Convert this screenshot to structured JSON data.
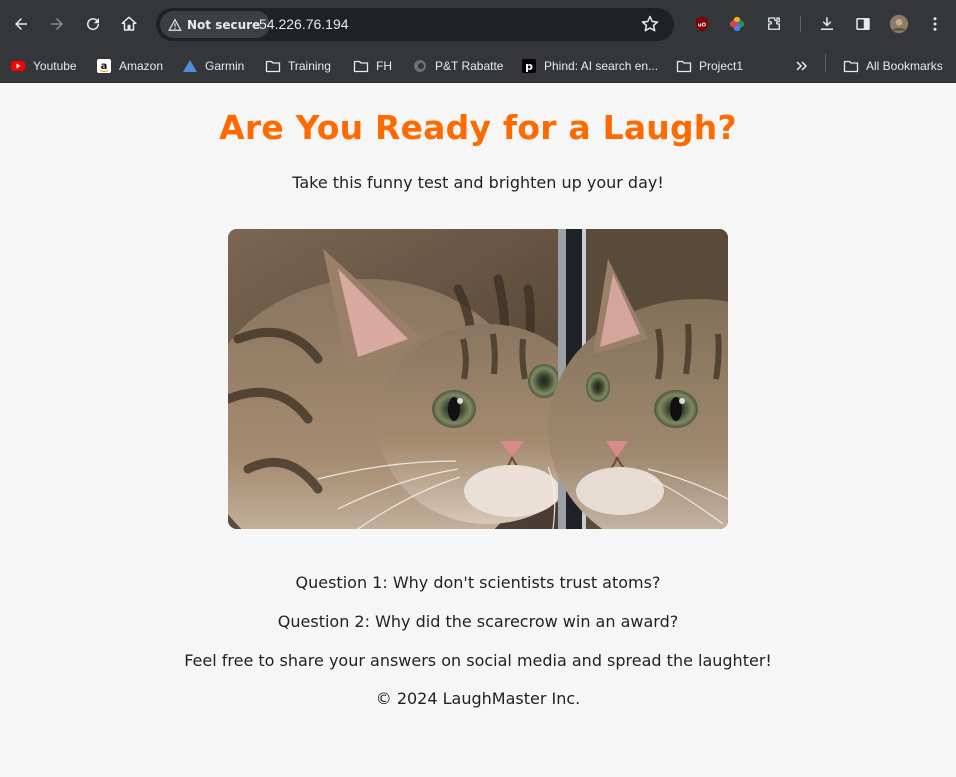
{
  "browser": {
    "security_label": "Not secure",
    "url": "54.226.76.194",
    "bookmarks": [
      {
        "label": "Youtube",
        "icon": "youtube-icon"
      },
      {
        "label": "Amazon",
        "icon": "amazon-icon"
      },
      {
        "label": "Garmin",
        "icon": "garmin-icon"
      },
      {
        "label": "Training",
        "icon": "folder-icon"
      },
      {
        "label": "FH",
        "icon": "folder-icon"
      },
      {
        "label": "P&T Rabatte",
        "icon": "pt-icon"
      },
      {
        "label": "Phind: AI search en...",
        "icon": "phind-icon"
      },
      {
        "label": "Project1",
        "icon": "folder-icon"
      }
    ],
    "all_bookmarks": "All Bookmarks"
  },
  "page": {
    "title": "Are You Ready for a Laugh?",
    "subtitle": "Take this funny test and brighten up your day!",
    "question1": "Question 1: Why don't scientists trust atoms?",
    "question2": "Question 2: Why did the scarecrow win an award?",
    "share": "Feel free to share your answers on social media and spread the laughter!",
    "footer": "© 2024 LaughMaster Inc."
  },
  "colors": {
    "title": "#ff6a00",
    "chrome_bg": "#35363a",
    "page_bg": "#f6f6f6"
  }
}
